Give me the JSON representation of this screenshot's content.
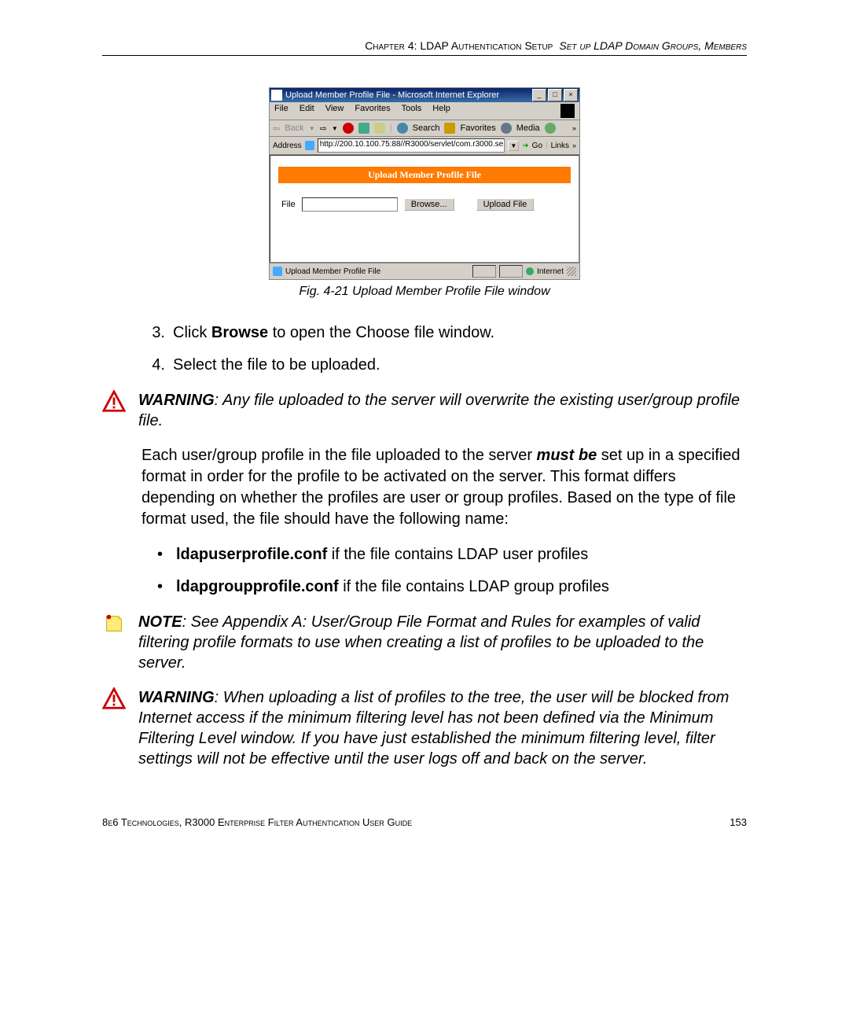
{
  "header": {
    "chapter": "Chapter 4: LDAP Authentication Setup",
    "section": "Set up LDAP Domain Groups, Members"
  },
  "ie_window": {
    "title": "Upload Member Profile File - Microsoft Internet Explorer",
    "menus": [
      "File",
      "Edit",
      "View",
      "Favorites",
      "Tools",
      "Help"
    ],
    "toolbar": {
      "back": "Back",
      "search": "Search",
      "favorites": "Favorites",
      "media": "Media"
    },
    "address_label": "Address",
    "address_value": "http://200.10.100.75:88//R3000/servlet/com.r3000.se",
    "go": "Go",
    "links": "Links",
    "content_title": "Upload Member Profile File",
    "file_label": "File",
    "browse_btn": "Browse...",
    "upload_btn": "Upload File",
    "status_left": "Upload Member Profile File",
    "status_right": "Internet"
  },
  "caption": "Fig. 4-21  Upload Member Profile File window",
  "steps": [
    {
      "num": "3.",
      "prefix": "Click ",
      "bold": "Browse",
      "suffix": " to open the Choose file window."
    },
    {
      "num": "4.",
      "prefix": "Select the file to be uploaded.",
      "bold": "",
      "suffix": ""
    }
  ],
  "warning1": {
    "label": "WARNING",
    "text": ": Any file uploaded to the server will overwrite the existing user/group profile file."
  },
  "paragraph": {
    "p1_a": "Each user/group profile in the file uploaded to the server ",
    "p1_bold": "must be",
    "p1_b": " set up in a specified format in order for the profile to be activated on the server. This format differs depending on whether the profiles are user or group profiles. Based on the type of file format used, the file should have the following name:"
  },
  "bullets": [
    {
      "bold": "ldapuserprofile.conf",
      "text": " if the file contains LDAP user profiles"
    },
    {
      "bold": "ldapgroupprofile.conf",
      "text": " if the file contains LDAP group profiles"
    }
  ],
  "note": {
    "label": "NOTE",
    "text": ": See Appendix A: User/Group File Format and Rules for examples of valid filtering profile formats to use when creating a list of profiles to be uploaded to the server."
  },
  "warning2": {
    "label": "WARNING",
    "text": ": When uploading a list of profiles to the tree, the user will be blocked from Internet access if the minimum filtering level has not been defined via the Minimum Filtering Level window. If you have just established the minimum filtering level, filter settings will not be effective until the user logs off and back on the server."
  },
  "footer": {
    "left": "8e6 Technologies, R3000 Enterprise Filter Authentication User Guide",
    "right": "153"
  }
}
